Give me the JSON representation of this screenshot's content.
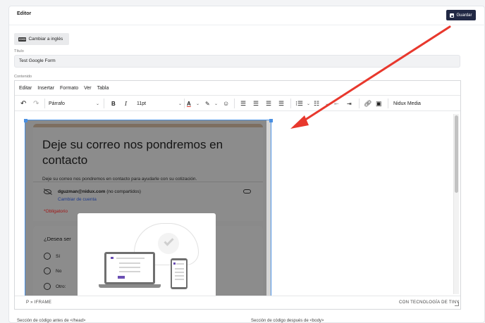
{
  "card": {
    "title": "Editor",
    "save_label": "Guardar"
  },
  "lang_button": "Cambiar a inglés",
  "title_field": {
    "label": "Título",
    "value": "Test Google Form"
  },
  "content_label": "Contenido",
  "menubar": [
    "Editar",
    "Insertar",
    "Formato",
    "Ver",
    "Tabla"
  ],
  "toolbar": {
    "block_format": "Párrafo",
    "font_size": "11pt",
    "media_label": "Nidux Media"
  },
  "form": {
    "title": "Deje su correo nos pondremos en contacto",
    "subtitle": "Deje su correo nos pondremos en contacto para ayudarle con su cotización.",
    "account_email": "dguzman@nidux.com",
    "account_note": "(no compartidos)",
    "switch_account": "Cambiar de cuenta",
    "required": "*Obligatorio",
    "question": "¿Desea ser",
    "options": [
      "Sí",
      "No",
      "Otro:"
    ]
  },
  "statusbar": {
    "path": "P » IFRAME",
    "powered": "CON TECNOLOGÍA DE TINY"
  },
  "footer": {
    "left": "Sección de código antes de </head>",
    "right": "Sección de código después de <body>"
  },
  "annotation": {
    "arrow_color": "#e8382d"
  }
}
